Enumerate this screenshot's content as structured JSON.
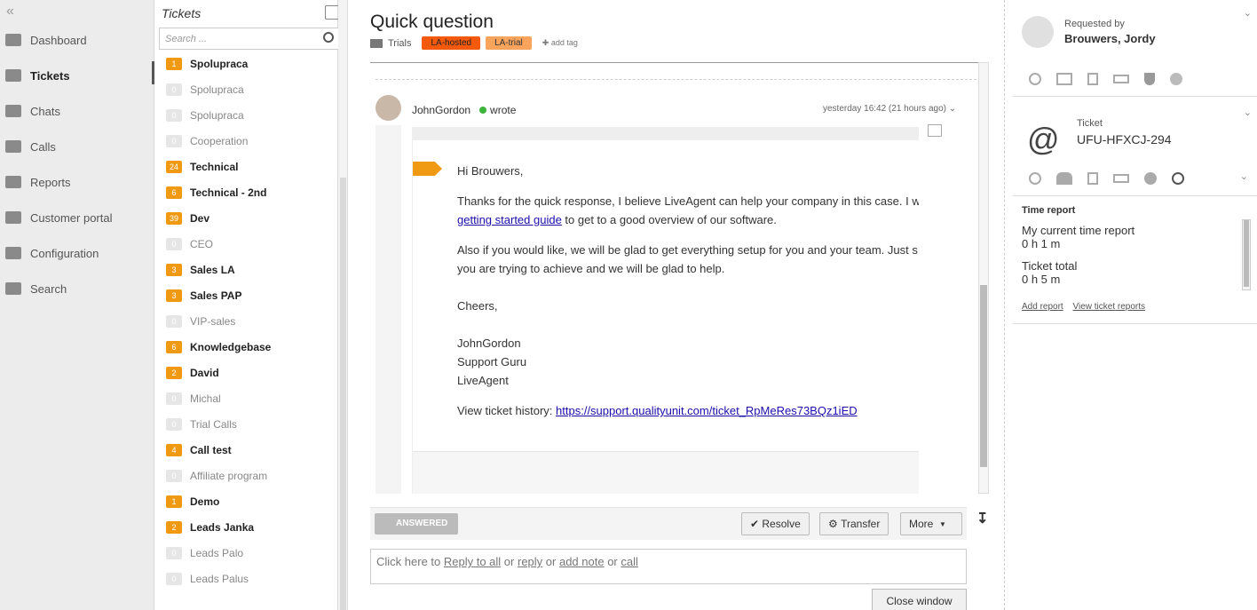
{
  "nav": {
    "items": [
      {
        "label": "Dashboard",
        "icon": "dashboard-icon"
      },
      {
        "label": "Tickets",
        "icon": "envelope-icon",
        "active": true
      },
      {
        "label": "Chats",
        "icon": "chat-icon"
      },
      {
        "label": "Calls",
        "icon": "phone-icon"
      },
      {
        "label": "Reports",
        "icon": "pie-chart-icon"
      },
      {
        "label": "Customer portal",
        "icon": "bank-icon"
      },
      {
        "label": "Configuration",
        "icon": "gear-icon"
      },
      {
        "label": "Search",
        "icon": "search-icon"
      }
    ]
  },
  "list": {
    "title": "Tickets",
    "search_placeholder": "Search ...",
    "rows": [
      {
        "count": "1",
        "label": "Spolupraca",
        "on": true
      },
      {
        "count": "0",
        "label": "Spolupraca",
        "on": false
      },
      {
        "count": "0",
        "label": "Spolupraca",
        "on": false
      },
      {
        "count": "0",
        "label": "Cooperation",
        "on": false
      },
      {
        "count": "24",
        "label": "Technical",
        "on": true
      },
      {
        "count": "6",
        "label": "Technical - 2nd",
        "on": true
      },
      {
        "count": "39",
        "label": "Dev",
        "on": true
      },
      {
        "count": "0",
        "label": "CEO",
        "on": false
      },
      {
        "count": "3",
        "label": "Sales LA",
        "on": true
      },
      {
        "count": "3",
        "label": "Sales PAP",
        "on": true
      },
      {
        "count": "0",
        "label": "VIP-sales",
        "on": false
      },
      {
        "count": "6",
        "label": "Knowledgebase",
        "on": true
      },
      {
        "count": "2",
        "label": "David",
        "on": true
      },
      {
        "count": "0",
        "label": "Michal",
        "on": false
      },
      {
        "count": "0",
        "label": "Trial Calls",
        "on": false
      },
      {
        "count": "4",
        "label": "Call test",
        "on": true
      },
      {
        "count": "0",
        "label": "Affiliate program",
        "on": false
      },
      {
        "count": "1",
        "label": "Demo",
        "on": true
      },
      {
        "count": "2",
        "label": "Leads Janka",
        "on": true
      },
      {
        "count": "0",
        "label": "Leads Palo",
        "on": false
      },
      {
        "count": "0",
        "label": "Leads Palus",
        "on": false
      }
    ]
  },
  "ticket": {
    "subject": "Quick question",
    "department": "Trials",
    "tags": [
      "LA-hosted",
      "LA-trial"
    ],
    "add_tag": "add tag",
    "author": "JohnGordon",
    "wrote": "wrote",
    "timestamp": "yesterday 16:42 (21 hours ago)",
    "greeting": "Hi Brouwers,",
    "p1a": "Thanks for the quick response, I believe LiveAgent can help your company in this case. I w",
    "p1link": "getting started guide",
    "p1b": " to get to a good overview of our software.",
    "p2a": "Also if you would like, we will be glad to get everything setup for you and your team. Just s",
    "p2b": "you are trying to achieve and we will be glad to help.",
    "cheers": "Cheers,",
    "sig1": "JohnGordon",
    "sig2": "Support Guru",
    "sig3": "LiveAgent",
    "history_label": "View ticket history: ",
    "history_link": "https://support.qualityunit.com/ticket_RpMeRes73BQz1iED"
  },
  "actions": {
    "status": "ANSWERED",
    "resolve": "Resolve",
    "transfer": "Transfer",
    "more": "More"
  },
  "reply": {
    "prefix": "Click here to ",
    "reply_all": "Reply to all",
    "or1": " or ",
    "reply": "reply",
    "or2": " or ",
    "note": "add note",
    "or3": " or ",
    "call": "call",
    "close": "Close window"
  },
  "requester": {
    "label": "Requested by",
    "name": "Brouwers, Jordy"
  },
  "ticket_panel": {
    "label": "Ticket",
    "code": "UFU-HFXCJ-294",
    "time_report": "Time report",
    "current_label": "My current time report",
    "current_value": "0 h 1 m",
    "total_label": "Ticket total",
    "total_value": "0 h 5 m",
    "add_report": "Add report",
    "view_reports": "View ticket reports"
  }
}
